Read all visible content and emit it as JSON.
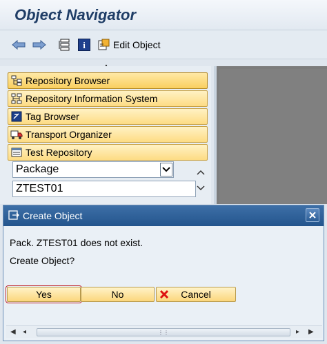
{
  "window": {
    "title": "Object Navigator"
  },
  "toolbar": {
    "edit_object_label": "Edit Object"
  },
  "nav": {
    "items": [
      {
        "label": "Repository Browser"
      },
      {
        "label": "Repository Information System"
      },
      {
        "label": "Tag Browser"
      },
      {
        "label": "Transport Organizer"
      },
      {
        "label": "Test Repository"
      }
    ],
    "object_type_select": {
      "value": "Package"
    },
    "object_name_input": {
      "value": "ZTEST01"
    }
  },
  "dialog": {
    "title": "Create Object",
    "message_line1": "Pack. ZTEST01 does not exist.",
    "message_line2": "Create Object?",
    "buttons": {
      "yes": "Yes",
      "no": "No",
      "cancel": "Cancel"
    }
  },
  "colors": {
    "title_text": "#1f3d66",
    "dialog_titlebar": "#2d5f98",
    "nav_button": "#fddc84",
    "focus_outline": "#c0242a"
  }
}
